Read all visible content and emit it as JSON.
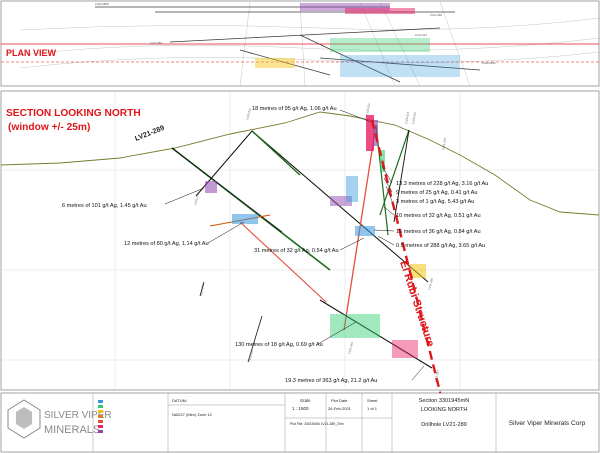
{
  "plan_view": {
    "title": "PLAN VIEW",
    "hole_labels": [
      "LV20-285D",
      "LV21-289",
      "LV21-224",
      "LV21-268",
      "LV20-284C"
    ]
  },
  "section": {
    "title_line1": "SECTION LOOKING NORTH",
    "title_line2": "(window +/- 25m)",
    "drillhole": "LV21-289",
    "structure": "El Rubi Structure",
    "hole_labels": [
      "LV20-201",
      "LV20-211",
      "LV20-213",
      "LV20-215",
      "LV21-219",
      "LV21-270",
      "LV21-292",
      "LV21-229",
      "LV21-280",
      "LV21-254",
      "LV21-297"
    ],
    "intercepts": [
      "18 metres of 95 g/t Ag, 1.06 g/t Au",
      "13.3 metres of 228 g/t Ag, 3.16 g/t Au",
      "9 metres of 25 g/t Ag, 0.41 g/t Au",
      "3 metres of 1 g/t Ag, 5.43 g/t Au",
      "6 metres of 101 g/t Ag, 1.45 g/t Au",
      "10 metres of 32 g/t Ag, 0.51 g/t Au",
      "15 metres of 36 g/t Ag, 0.84 g/t Au",
      "12 metres of 80 g/t Ag, 1.14 g/t Au",
      "0.5 metres of 288 g/t Ag, 3.65 g/t Au",
      "31 metres of 32 g/t Ag, 0.54 g/t Au",
      "130 metres of 18 g/t Ag, 0.69 g/t Au",
      "19.3 metres of 363 g/t Ag, 21.2 g/t Au"
    ]
  },
  "title_block": {
    "logo_line1": "SILVER VIPER",
    "logo_line2": "MINERALS",
    "datum_label": "DATUM:",
    "datum": "NAD27 (Mex) Zone 12",
    "scale_label": "Scale",
    "scale": "1 : 1500",
    "plot_date_label": "Plot Date",
    "plot_date": "26-Feb-2021",
    "sheet_label": "Sheet",
    "sheet": "1 of 1",
    "plot_file": "Plot File: 3301945N LV21-289_20m",
    "section_no": "Section 3301945mN",
    "looking": "LOOKING NORTH",
    "drillhole_line": "Drillhole LV21-289",
    "company": "Silver Viper Minerals Corp"
  }
}
